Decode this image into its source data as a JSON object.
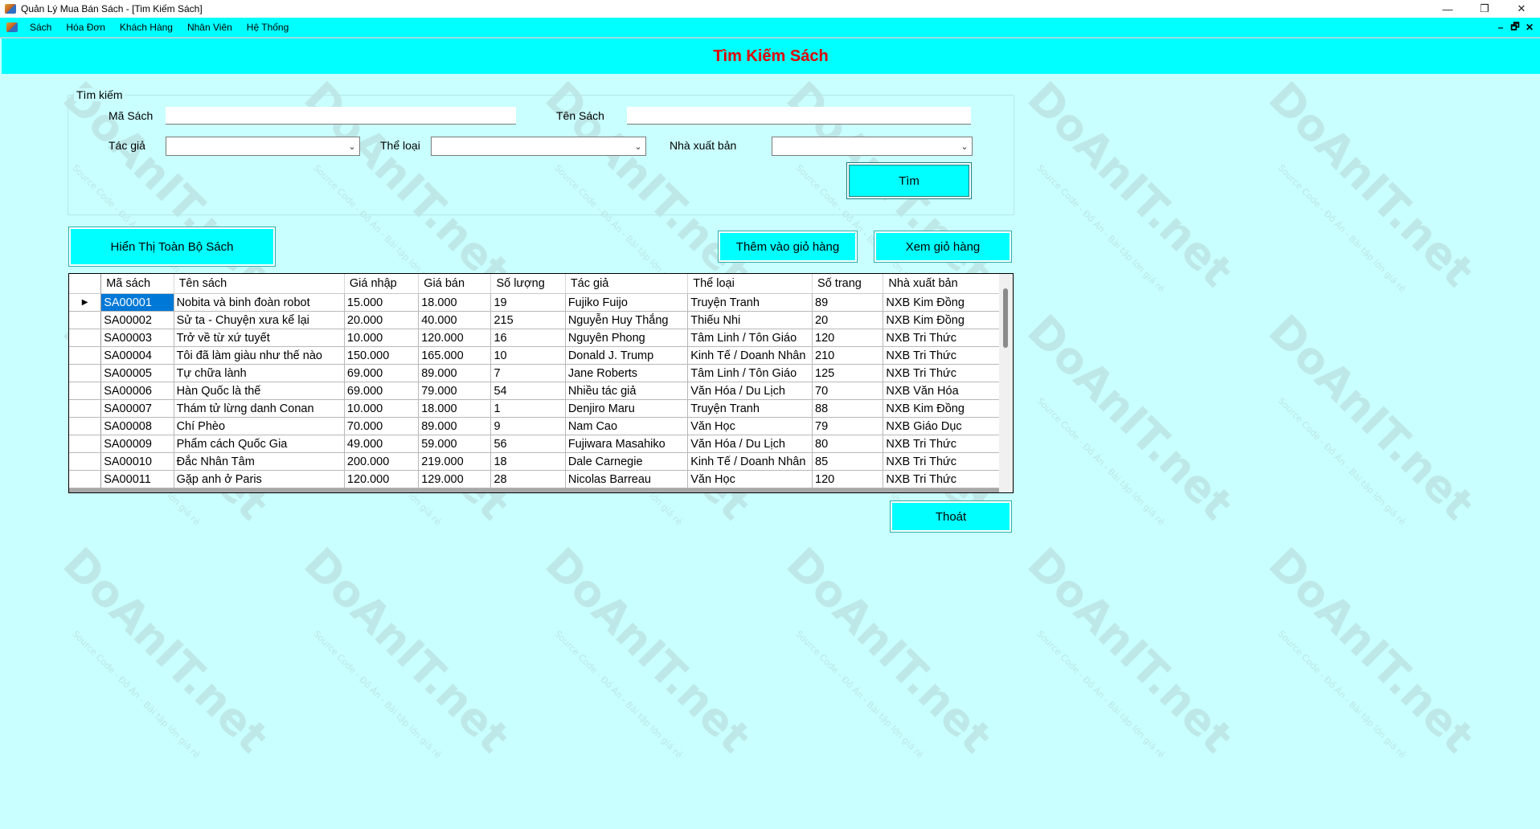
{
  "window": {
    "title": "Quản Lý Mua Bán Sách - [Tim Kiếm Sách]",
    "minimize": "—",
    "maximize": "❐",
    "close": "✕"
  },
  "menu": {
    "items": [
      "Sách",
      "Hóa Đơn",
      "Khách Hàng",
      "Nhân Viên",
      "Hệ Thống"
    ],
    "mdi_minimize": "–",
    "mdi_restore": "🗗",
    "mdi_close": "✕"
  },
  "form": {
    "title": "Tìm Kiếm Sách"
  },
  "search": {
    "group_label": "Tìm kiếm",
    "ma_sach_label": "Mã Sách",
    "ma_sach_value": "",
    "ten_sach_label": "Tên Sách",
    "ten_sach_value": "",
    "tac_gia_label": "Tác giả",
    "tac_gia_value": "",
    "the_loai_label": "Thể loại",
    "the_loai_value": "",
    "nxb_label": "Nhà xuất bản",
    "nxb_value": "",
    "tim_button": "Tìm"
  },
  "actions": {
    "show_all": "Hiển Thị Toàn Bộ Sách",
    "add_to_cart": "Thêm vào giỏ hàng",
    "view_cart": "Xem giỏ hàng",
    "exit": "Thoát"
  },
  "grid": {
    "columns": [
      "Mã sách",
      "Tên sách",
      "Giá nhập",
      "Giá bán",
      "Số lượng",
      "Tác giả",
      "Thể loại",
      "Số trang",
      "Nhà xuất bản"
    ],
    "rows": [
      [
        "SA00001",
        "Nobita và binh đoàn robot",
        "15.000",
        "18.000",
        "19",
        "Fujiko Fuijo",
        "Truyện Tranh",
        "89",
        "NXB Kim Đồng"
      ],
      [
        "SA00002",
        "Sử ta - Chuyện xưa kể lại",
        "20.000",
        "40.000",
        "215",
        "Nguyễn Huy Thắng",
        "Thiếu Nhi",
        "20",
        "NXB Kim Đồng"
      ],
      [
        "SA00003",
        "Trở về từ xứ tuyết",
        "10.000",
        "120.000",
        "16",
        "Nguyên Phong",
        "Tâm Linh / Tôn Giáo",
        "120",
        "NXB Tri Thức"
      ],
      [
        "SA00004",
        "Tôi đã làm giàu như thế nào",
        "150.000",
        "165.000",
        "10",
        "Donald J. Trump",
        "Kinh Tế / Doanh Nhân",
        "210",
        "NXB Tri Thức"
      ],
      [
        "SA00005",
        "Tự chữa lành",
        "69.000",
        "89.000",
        "7",
        "Jane Roberts",
        "Tâm Linh / Tôn Giáo",
        "125",
        "NXB Tri Thức"
      ],
      [
        "SA00006",
        "Hàn Quốc là thế",
        "69.000",
        "79.000",
        "54",
        "Nhiều tác giả",
        "Văn Hóa / Du Lịch",
        "70",
        "NXB Văn Hóa"
      ],
      [
        "SA00007",
        "Thám tử lừng danh Conan",
        "10.000",
        "18.000",
        "1",
        "Denjiro Maru",
        "Truyện Tranh",
        "88",
        "NXB Kim Đồng"
      ],
      [
        "SA00008",
        "Chí Phèo",
        "70.000",
        "89.000",
        "9",
        "Nam Cao",
        "Văn Học",
        "79",
        "NXB Giáo Dục"
      ],
      [
        "SA00009",
        "Phẩm cách Quốc Gia",
        "49.000",
        "59.000",
        "56",
        "Fujiwara Masahiko",
        "Văn Hóa / Du Lịch",
        "80",
        "NXB Tri Thức"
      ],
      [
        "SA00010",
        "Đắc Nhân Tâm",
        "200.000",
        "219.000",
        "18",
        "Dale Carnegie",
        "Kinh Tế / Doanh Nhân",
        "85",
        "NXB Tri Thức"
      ],
      [
        "SA00011",
        "Gặp anh ở Paris",
        "120.000",
        "129.000",
        "28",
        "Nicolas Barreau",
        "Văn Học",
        "120",
        "NXB Tri Thức"
      ]
    ],
    "current_row_marker": "▶"
  },
  "watermark": {
    "brand": "DoAnIT.net",
    "tagline": "Source Code - Đồ Án - Bài tập lớn giá rẻ"
  },
  "colors": {
    "background": "#c9ffff",
    "accent": "#00ffff",
    "title_text": "#e00000",
    "selection": "#0078d7"
  }
}
